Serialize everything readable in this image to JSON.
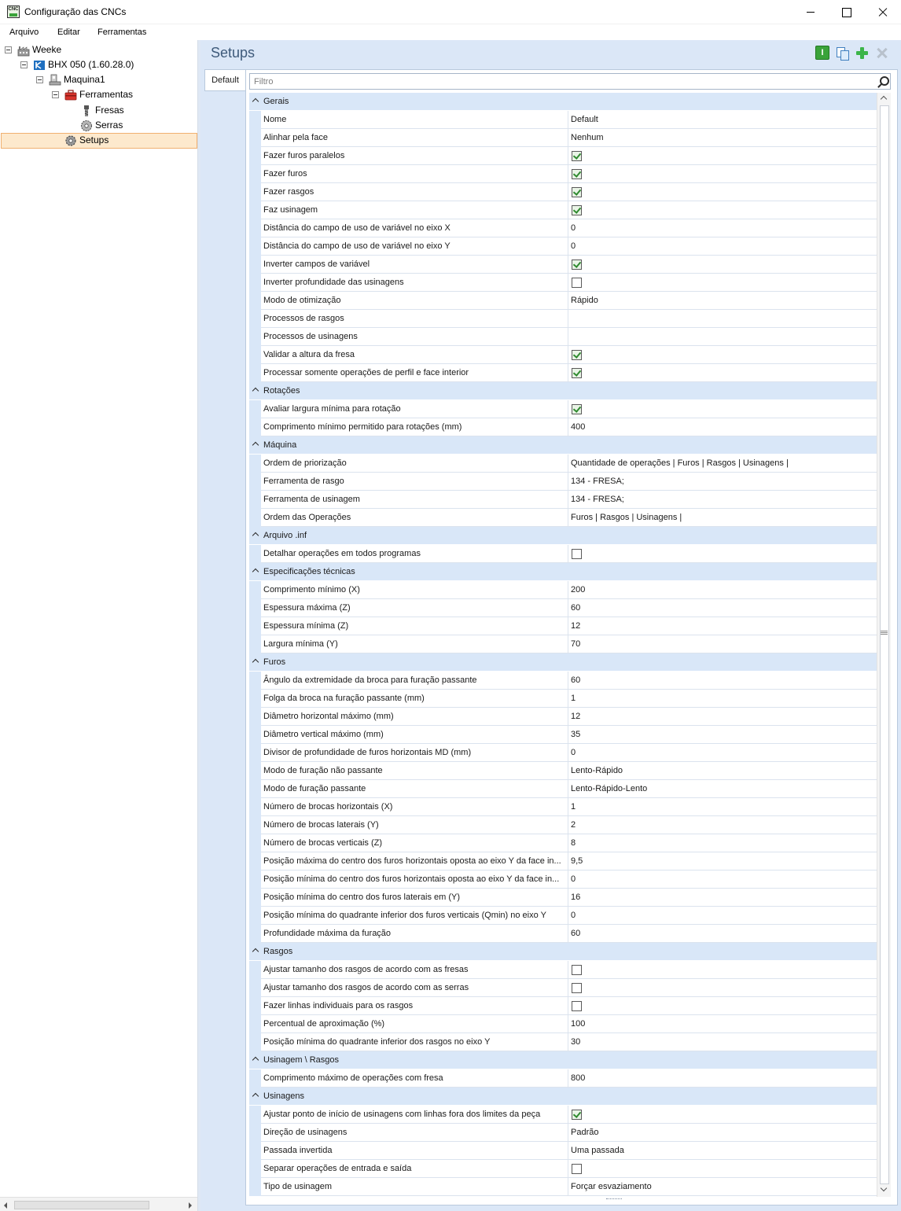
{
  "window": {
    "title": "Configuração das CNCs",
    "app_icon_text": "CNC"
  },
  "menu": [
    "Arquivo",
    "Editar",
    "Ferramentas"
  ],
  "tree": {
    "nodes": [
      {
        "label": "Weeke",
        "icon": "factory-icon",
        "level": 0,
        "expandable": true
      },
      {
        "label": "BHX 050 (1.60.28.0)",
        "icon": "cnc-machine-icon",
        "level": 1,
        "expandable": true
      },
      {
        "label": "Maquina1",
        "icon": "machine-icon",
        "level": 2,
        "expandable": true
      },
      {
        "label": "Ferramentas",
        "icon": "toolbox-icon",
        "level": 3,
        "expandable": true
      },
      {
        "label": "Fresas",
        "icon": "router-bit-icon",
        "level": 4,
        "expandable": false
      },
      {
        "label": "Serras",
        "icon": "saw-blade-icon",
        "level": 4,
        "expandable": false
      },
      {
        "label": "Setups",
        "icon": "gear-icon",
        "level": 3,
        "expandable": false,
        "selected": true
      }
    ]
  },
  "main": {
    "title": "Setups",
    "toolbar": [
      "info-icon",
      "copy-icon",
      "add-icon",
      "delete-icon"
    ],
    "tab_label": "Default",
    "filter_placeholder": "Filtro"
  },
  "grid": [
    {
      "category": "Gerais",
      "props": [
        {
          "name": "Nome",
          "type": "text",
          "value": "Default"
        },
        {
          "name": "Alinhar pela face",
          "type": "text",
          "value": "Nenhum"
        },
        {
          "name": "Fazer furos paralelos",
          "type": "bool",
          "value": true
        },
        {
          "name": "Fazer furos",
          "type": "bool",
          "value": true
        },
        {
          "name": "Fazer rasgos",
          "type": "bool",
          "value": true
        },
        {
          "name": "Faz usinagem",
          "type": "bool",
          "value": true
        },
        {
          "name": "Distância do campo de uso de variável no eixo X",
          "type": "text",
          "value": "0"
        },
        {
          "name": "Distância do campo de uso de variável no eixo Y",
          "type": "text",
          "value": "0"
        },
        {
          "name": "Inverter campos de variável",
          "type": "bool",
          "value": true
        },
        {
          "name": "Inverter profundidade das usinagens",
          "type": "bool",
          "value": false
        },
        {
          "name": "Modo de otimização",
          "type": "text",
          "value": "Rápido"
        },
        {
          "name": "Processos de rasgos",
          "type": "text",
          "value": ""
        },
        {
          "name": "Processos de usinagens",
          "type": "text",
          "value": ""
        },
        {
          "name": "Validar a altura da fresa",
          "type": "bool",
          "value": true
        },
        {
          "name": "Processar somente operações de perfil e face interior",
          "type": "bool",
          "value": true
        }
      ]
    },
    {
      "category": "Rotações",
      "props": [
        {
          "name": "Avaliar largura mínima para rotação",
          "type": "bool",
          "value": true
        },
        {
          "name": "Comprimento mínimo permitido para rotações (mm)",
          "type": "text",
          "value": "400"
        }
      ]
    },
    {
      "category": "Máquina",
      "props": [
        {
          "name": "Ordem de priorização",
          "type": "text",
          "value": "Quantidade de operações | Furos | Rasgos | Usinagens |"
        },
        {
          "name": "Ferramenta de rasgo",
          "type": "text",
          "value": "134 - FRESA;"
        },
        {
          "name": "Ferramenta de usinagem",
          "type": "text",
          "value": "134 - FRESA;"
        },
        {
          "name": "Ordem das Operações",
          "type": "text",
          "value": "Furos | Rasgos | Usinagens |"
        }
      ]
    },
    {
      "category": "Arquivo .inf",
      "props": [
        {
          "name": "Detalhar operações em todos programas",
          "type": "bool",
          "value": false
        }
      ]
    },
    {
      "category": "Especificações técnicas",
      "props": [
        {
          "name": "Comprimento mínimo (X)",
          "type": "text",
          "value": "200"
        },
        {
          "name": "Espessura máxima (Z)",
          "type": "text",
          "value": "60"
        },
        {
          "name": "Espessura mínima (Z)",
          "type": "text",
          "value": "12"
        },
        {
          "name": "Largura mínima (Y)",
          "type": "text",
          "value": "70"
        }
      ]
    },
    {
      "category": "Furos",
      "props": [
        {
          "name": "Ângulo da extremidade da broca para furação passante",
          "type": "text",
          "value": "60"
        },
        {
          "name": "Folga da broca na furação passante (mm)",
          "type": "text",
          "value": "1"
        },
        {
          "name": "Diâmetro horizontal máximo (mm)",
          "type": "text",
          "value": "12"
        },
        {
          "name": "Diâmetro vertical máximo (mm)",
          "type": "text",
          "value": "35"
        },
        {
          "name": "Divisor de profundidade de furos horizontais MD (mm)",
          "type": "text",
          "value": "0"
        },
        {
          "name": "Modo de furação não passante",
          "type": "text",
          "value": "Lento-Rápido"
        },
        {
          "name": "Modo de furação passante",
          "type": "text",
          "value": "Lento-Rápido-Lento"
        },
        {
          "name": "Número de brocas horizontais (X)",
          "type": "text",
          "value": "1"
        },
        {
          "name": "Número de brocas laterais (Y)",
          "type": "text",
          "value": "2"
        },
        {
          "name": "Número de brocas verticais (Z)",
          "type": "text",
          "value": "8"
        },
        {
          "name": "Posição máxima do centro dos furos horizontais oposta ao eixo Y da face in...",
          "type": "text",
          "value": "9,5"
        },
        {
          "name": "Posição mínima do centro dos furos horizontais oposta ao eixo Y da face in...",
          "type": "text",
          "value": "0"
        },
        {
          "name": "Posição mínima do centro dos furos laterais em (Y)",
          "type": "text",
          "value": "16"
        },
        {
          "name": "Posição mínima do quadrante inferior dos furos verticais (Qmin) no eixo Y",
          "type": "text",
          "value": "0"
        },
        {
          "name": "Profundidade máxima da furação",
          "type": "text",
          "value": "60"
        }
      ]
    },
    {
      "category": "Rasgos",
      "props": [
        {
          "name": "Ajustar tamanho dos rasgos de acordo com as fresas",
          "type": "bool",
          "value": false
        },
        {
          "name": "Ajustar tamanho dos rasgos de acordo com as serras",
          "type": "bool",
          "value": false
        },
        {
          "name": "Fazer linhas individuais para os rasgos",
          "type": "bool",
          "value": false
        },
        {
          "name": "Percentual de aproximação (%)",
          "type": "text",
          "value": "100"
        },
        {
          "name": "Posição mínima do quadrante inferior dos rasgos no eixo Y",
          "type": "text",
          "value": "30"
        }
      ]
    },
    {
      "category": "Usinagem \\ Rasgos",
      "props": [
        {
          "name": "Comprimento máximo de operações com fresa",
          "type": "text",
          "value": "800"
        }
      ]
    },
    {
      "category": "Usinagens",
      "props": [
        {
          "name": "Ajustar ponto de início de usinagens com linhas fora dos limites da peça",
          "type": "bool",
          "value": true
        },
        {
          "name": "Direção de usinagens",
          "type": "text",
          "value": "Padrão"
        },
        {
          "name": "Passada invertida",
          "type": "text",
          "value": "Uma passada"
        },
        {
          "name": "Separar operações de entrada e saída",
          "type": "bool",
          "value": false
        },
        {
          "name": "Tipo de usinagem",
          "type": "text",
          "value": "Forçar esvaziamento"
        }
      ]
    }
  ]
}
